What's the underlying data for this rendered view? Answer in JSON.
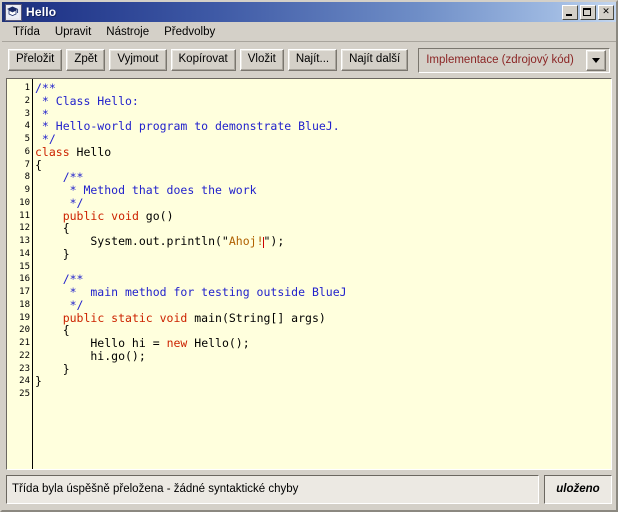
{
  "window": {
    "title": "Hello",
    "icon": "bluej-class-icon",
    "controls": [
      {
        "name": "minimize-button",
        "glyph": "minimize-icon"
      },
      {
        "name": "maximize-button",
        "glyph": "maximize-icon"
      },
      {
        "name": "close-button",
        "glyph": "close-icon",
        "label": "✕"
      }
    ]
  },
  "menubar": {
    "items": [
      {
        "label": "Třída"
      },
      {
        "label": "Upravit"
      },
      {
        "label": "Nástroje"
      },
      {
        "label": "Předvolby"
      }
    ]
  },
  "toolbar": {
    "buttons": [
      {
        "label": "Přeložit"
      },
      {
        "label": "Zpět"
      },
      {
        "label": "Vyjmout"
      },
      {
        "label": "Kopírovat"
      },
      {
        "label": "Vložit"
      },
      {
        "label": "Najít..."
      },
      {
        "label": "Najít další"
      }
    ],
    "view_selector": {
      "value": "Implementace (zdrojový kód)",
      "color": "#8b2525",
      "arrow_icon": "chevron-down-icon"
    }
  },
  "editor": {
    "background": "#ffffdd",
    "line_numbers": [
      1,
      2,
      3,
      4,
      5,
      6,
      7,
      8,
      9,
      10,
      11,
      12,
      13,
      14,
      15,
      16,
      17,
      18,
      19,
      20,
      21,
      22,
      23,
      24,
      25
    ],
    "colors": {
      "comment": "#2222cc",
      "keyword": "#cc2200",
      "string": "#b06000",
      "plain": "#000000",
      "caret": "#cc0000"
    },
    "lines": [
      {
        "n": 1,
        "segments": [
          {
            "t": "cmt",
            "v": "/**"
          }
        ]
      },
      {
        "n": 2,
        "segments": [
          {
            "t": "cmt",
            "v": " * Class Hello:"
          }
        ]
      },
      {
        "n": 3,
        "segments": [
          {
            "t": "cmt",
            "v": " *"
          }
        ]
      },
      {
        "n": 4,
        "segments": [
          {
            "t": "cmt",
            "v": " * Hello-world program to demonstrate BlueJ."
          }
        ]
      },
      {
        "n": 5,
        "segments": [
          {
            "t": "cmt",
            "v": " */"
          }
        ]
      },
      {
        "n": 6,
        "segments": [
          {
            "t": "kw",
            "v": "class"
          },
          {
            "t": "p",
            "v": " Hello"
          }
        ]
      },
      {
        "n": 7,
        "segments": [
          {
            "t": "p",
            "v": "{"
          }
        ]
      },
      {
        "n": 8,
        "segments": [
          {
            "t": "cmt",
            "v": "    /**"
          }
        ]
      },
      {
        "n": 9,
        "segments": [
          {
            "t": "cmt",
            "v": "     * Method that does the work"
          }
        ]
      },
      {
        "n": 10,
        "segments": [
          {
            "t": "cmt",
            "v": "     */"
          }
        ]
      },
      {
        "n": 11,
        "segments": [
          {
            "t": "p",
            "v": "    "
          },
          {
            "t": "kw",
            "v": "public void"
          },
          {
            "t": "p",
            "v": " go()"
          }
        ]
      },
      {
        "n": 12,
        "segments": [
          {
            "t": "p",
            "v": "    {"
          }
        ]
      },
      {
        "n": 13,
        "segments": [
          {
            "t": "p",
            "v": "        System.out.println(\""
          },
          {
            "t": "str",
            "v": "Ahoj!"
          },
          {
            "t": "caret",
            "v": "|"
          },
          {
            "t": "p",
            "v": "\");"
          }
        ]
      },
      {
        "n": 14,
        "segments": [
          {
            "t": "p",
            "v": "    }"
          }
        ]
      },
      {
        "n": 15,
        "segments": [
          {
            "t": "p",
            "v": ""
          }
        ]
      },
      {
        "n": 16,
        "segments": [
          {
            "t": "cmt",
            "v": "    /**"
          }
        ]
      },
      {
        "n": 17,
        "segments": [
          {
            "t": "cmt",
            "v": "     *  main method for testing outside BlueJ"
          }
        ]
      },
      {
        "n": 18,
        "segments": [
          {
            "t": "cmt",
            "v": "     */"
          }
        ]
      },
      {
        "n": 19,
        "segments": [
          {
            "t": "p",
            "v": "    "
          },
          {
            "t": "kw",
            "v": "public static void"
          },
          {
            "t": "p",
            "v": " main(String[] args)"
          }
        ]
      },
      {
        "n": 20,
        "segments": [
          {
            "t": "p",
            "v": "    {"
          }
        ]
      },
      {
        "n": 21,
        "segments": [
          {
            "t": "p",
            "v": "        Hello hi = "
          },
          {
            "t": "kw",
            "v": "new"
          },
          {
            "t": "p",
            "v": " Hello();"
          }
        ]
      },
      {
        "n": 22,
        "segments": [
          {
            "t": "p",
            "v": "        hi.go();"
          }
        ]
      },
      {
        "n": 23,
        "segments": [
          {
            "t": "p",
            "v": "    }"
          }
        ]
      },
      {
        "n": 24,
        "segments": [
          {
            "t": "p",
            "v": "}"
          }
        ]
      },
      {
        "n": 25,
        "segments": [
          {
            "t": "p",
            "v": ""
          }
        ]
      }
    ]
  },
  "statusbar": {
    "message": "Třída byla úspěšně přeložena - žádné syntaktické chyby",
    "saved_label": "uloženo"
  }
}
